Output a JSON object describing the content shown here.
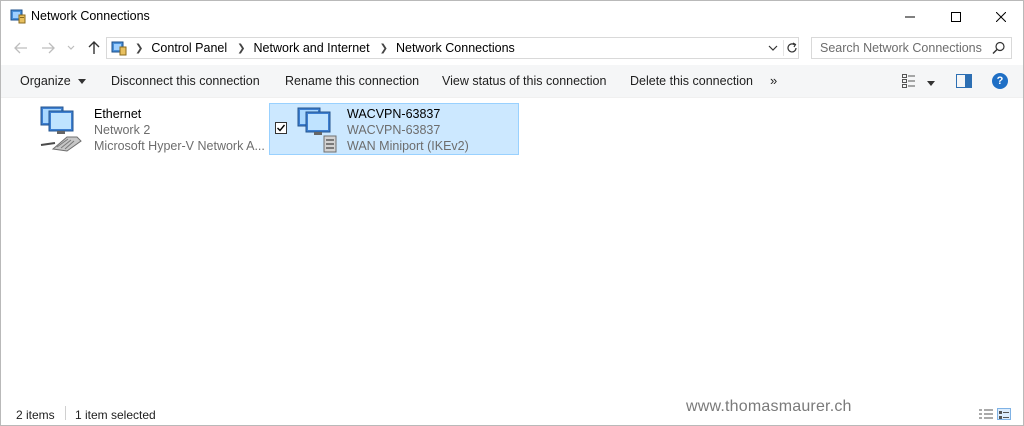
{
  "window": {
    "title": "Network Connections"
  },
  "address_bar": {
    "breadcrumbs": [
      "Control Panel",
      "Network and Internet",
      "Network Connections"
    ]
  },
  "search": {
    "placeholder": "Search Network Connections"
  },
  "command_bar": {
    "organize": "Organize",
    "disconnect": "Disconnect this connection",
    "rename": "Rename this connection",
    "view_status": "View status of this connection",
    "delete": "Delete this connection",
    "more": "»",
    "help": "?"
  },
  "connections": [
    {
      "name": "Ethernet",
      "network": "Network 2",
      "device": "Microsoft Hyper-V Network A...",
      "icon": "ethernet-adapter-icon",
      "selected": false
    },
    {
      "name": "WACVPN-63837",
      "network": "WACVPN-63837",
      "device": "WAN Miniport (IKEv2)",
      "icon": "vpn-connection-icon",
      "selected": true
    }
  ],
  "status_bar": {
    "item_count": "2 items",
    "selected_count": "1 item selected",
    "watermark": "www.thomasmaurer.ch"
  },
  "colors": {
    "selection_fill": "#cce8ff",
    "selection_border": "#99d1ff",
    "help_blue": "#1f6fc5"
  }
}
